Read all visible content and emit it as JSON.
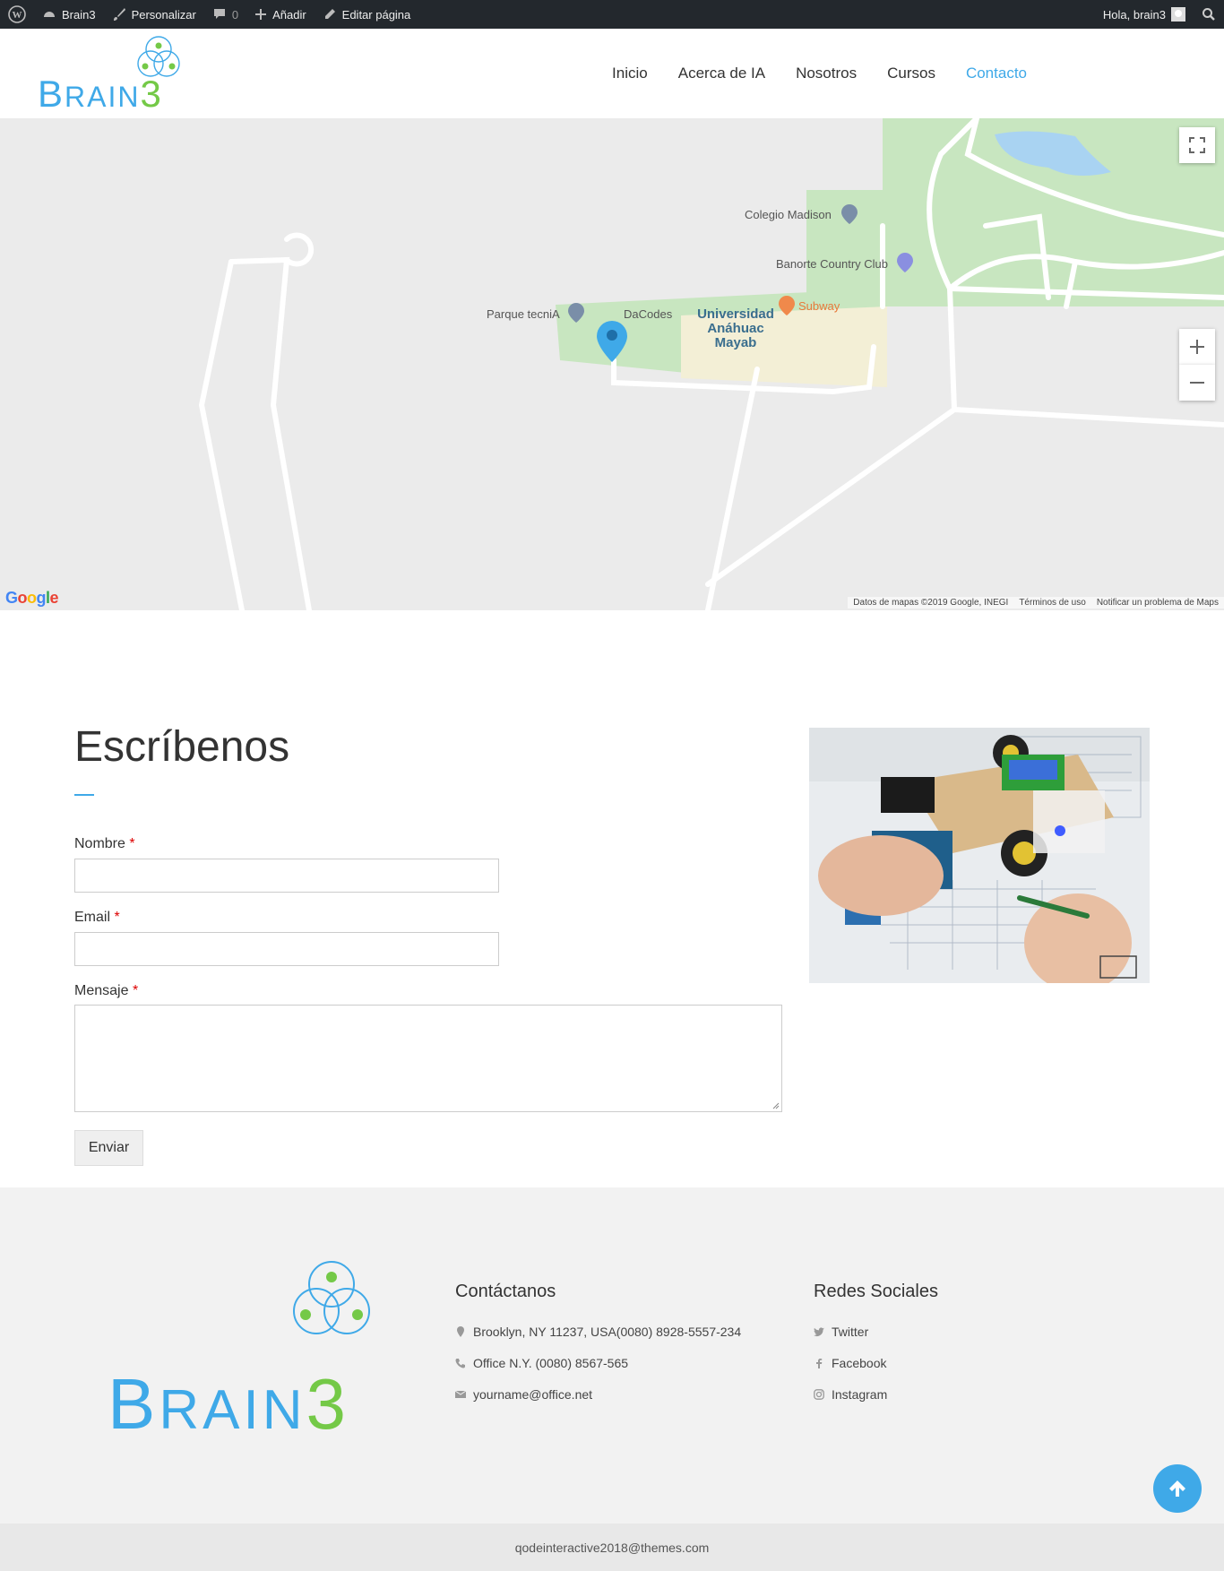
{
  "adminbar": {
    "site": "Brain3",
    "customize": "Personalizar",
    "comments": "0",
    "add": "Añadir",
    "edit": "Editar página",
    "greeting": "Hola, brain3"
  },
  "logo": {
    "b": "B",
    "rest": "RAIN",
    "three": "3"
  },
  "nav": [
    {
      "label": "Inicio"
    },
    {
      "label": "Acerca de IA"
    },
    {
      "label": "Nosotros"
    },
    {
      "label": "Cursos"
    },
    {
      "label": "Contacto"
    }
  ],
  "map": {
    "labels": {
      "colegio": "Colegio Madison",
      "banorte": "Banorte Country Club",
      "parque": "Parque tecniA",
      "dacodes": "DaCodes",
      "subway": "Subway",
      "uni": "Universidad Anáhuac Mayab"
    },
    "google": "Google",
    "footer": {
      "data": "Datos de mapas ©2019 Google, INEGI",
      "terms": "Términos de uso",
      "report": "Notificar un problema de Maps"
    }
  },
  "contact": {
    "title": "Escríbenos",
    "name_label": "Nombre",
    "email_label": "Email",
    "message_label": "Mensaje",
    "required": "*",
    "submit": "Enviar"
  },
  "footer": {
    "contact_title": "Contáctanos",
    "address": "Brooklyn, NY 11237, USA(0080) 8928-5557-234",
    "office": "Office N.Y. (0080) 8567-565",
    "email": "yourname@office.net",
    "social_title": "Redes Sociales",
    "social": [
      {
        "label": "Twitter"
      },
      {
        "label": "Facebook"
      },
      {
        "label": "Instagram"
      }
    ],
    "bottom": "qodeinteractive2018@themes.com"
  },
  "colors": {
    "accent": "#3fa9e8",
    "green": "#74c947",
    "adminbar": "#23282d"
  }
}
